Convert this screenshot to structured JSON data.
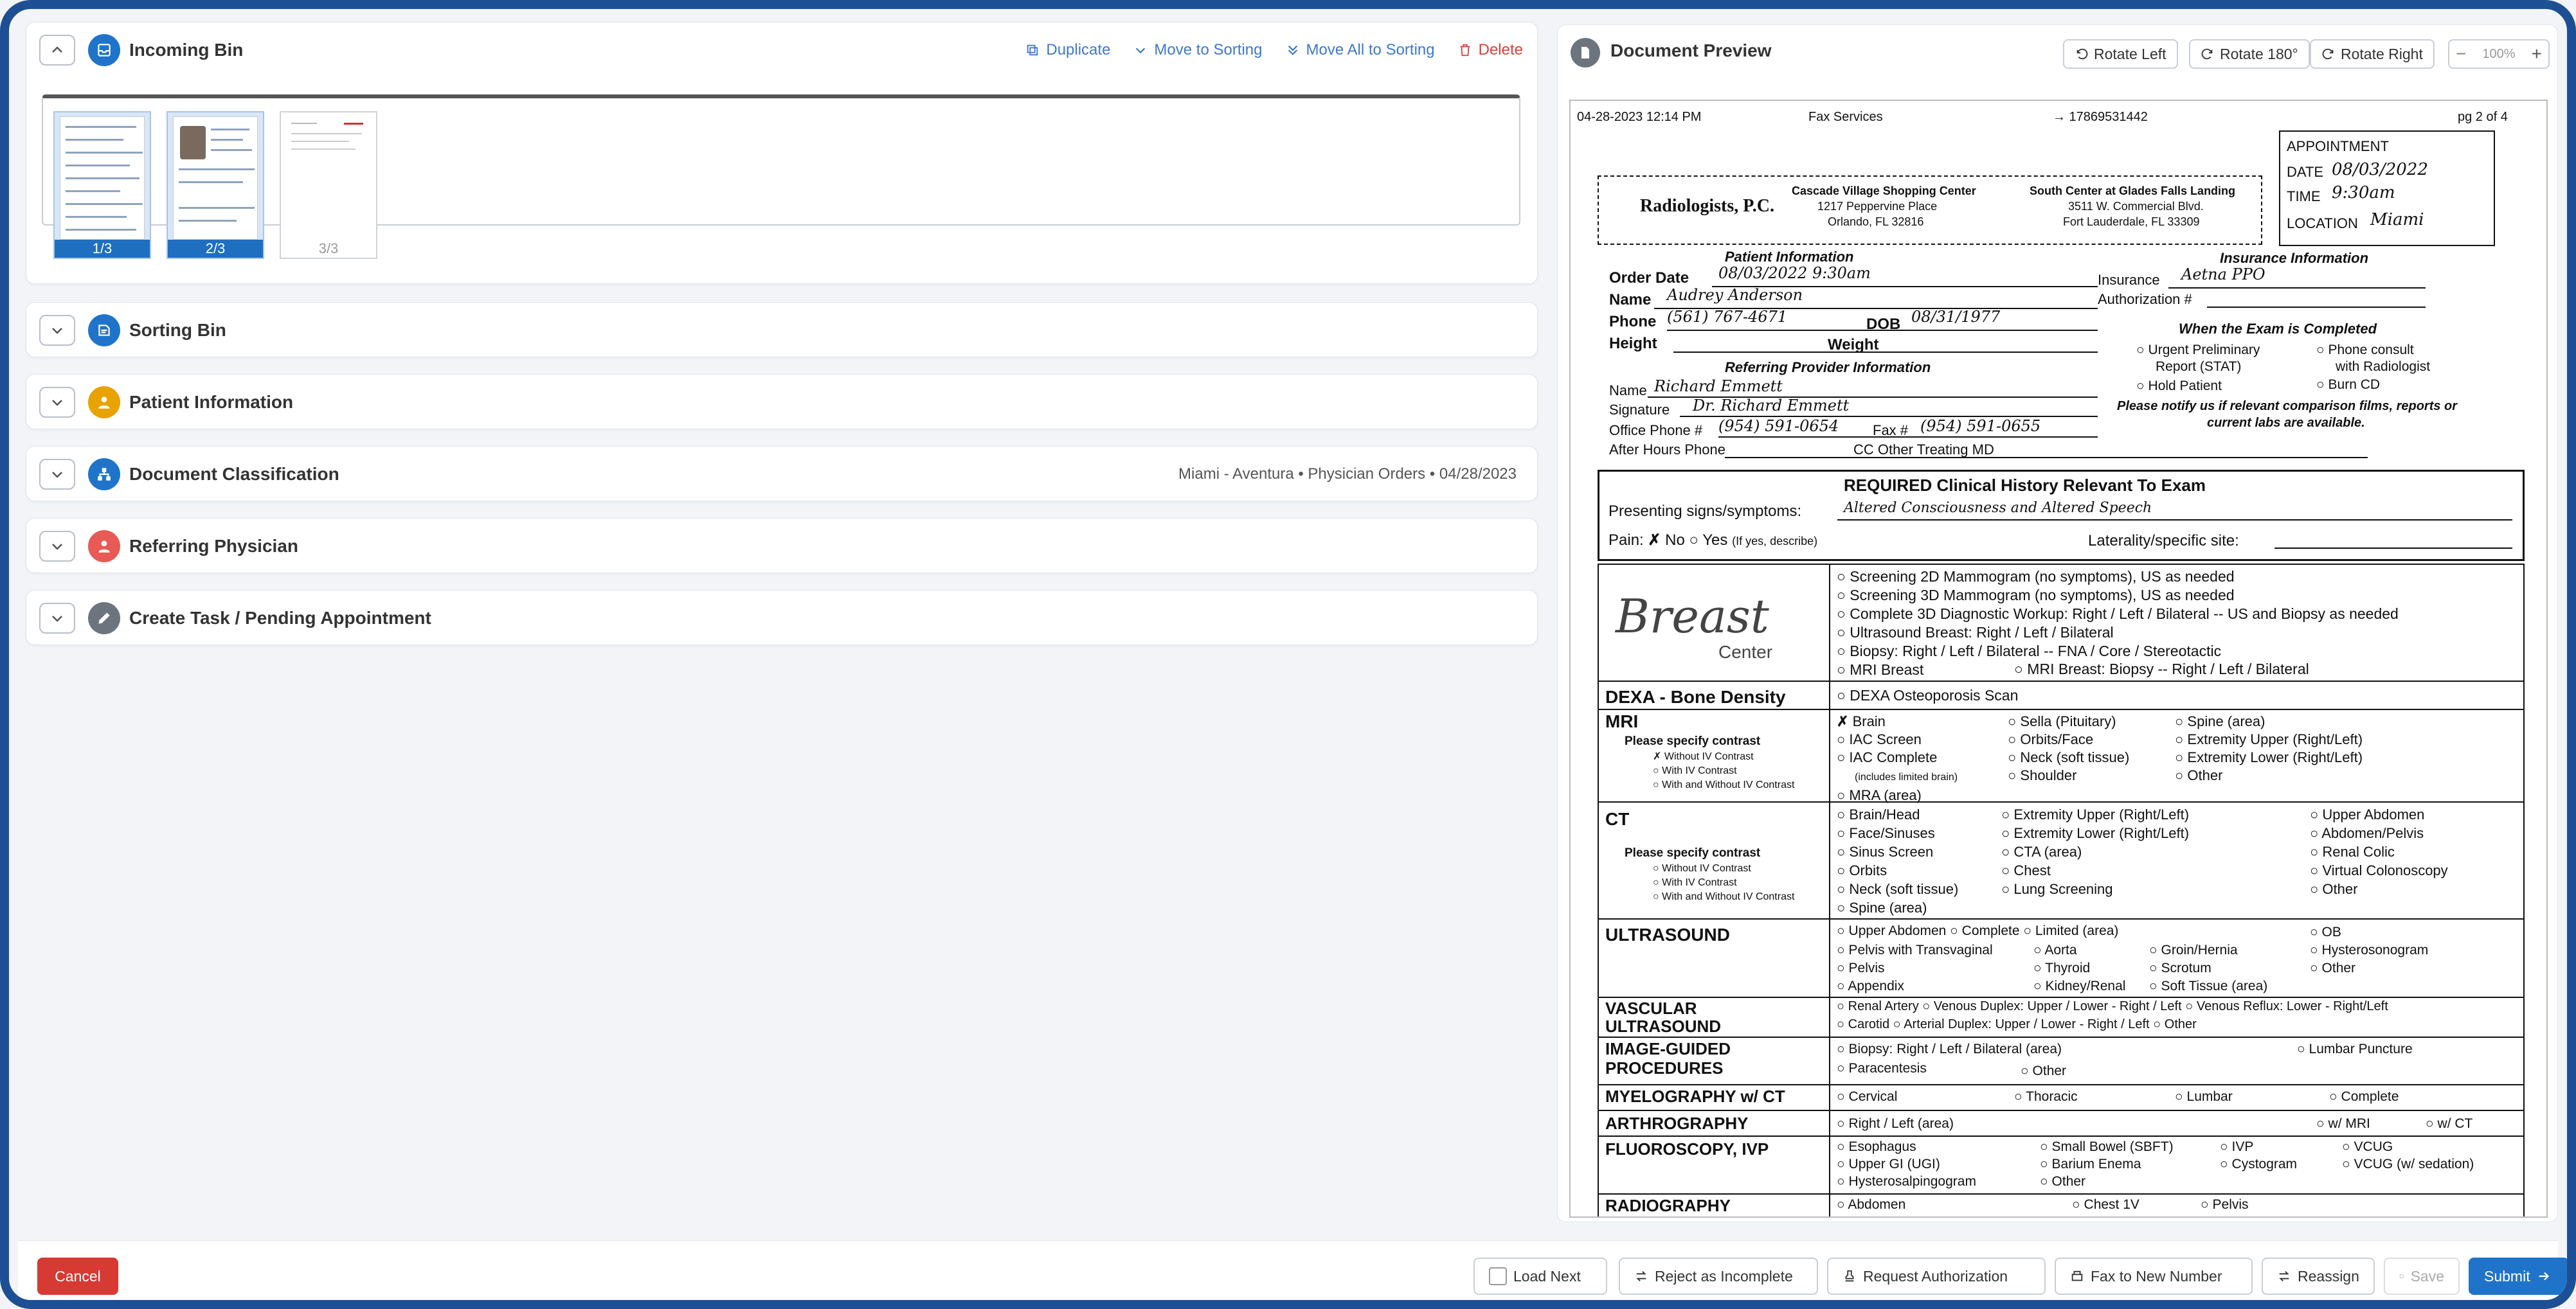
{
  "incoming_bin": {
    "title": "Incoming Bin",
    "actions": {
      "duplicate": "Duplicate",
      "move_to_sorting": "Move to Sorting",
      "move_all_to_sorting": "Move All to Sorting",
      "delete": "Delete"
    },
    "thumbnails": [
      {
        "label": "1/3",
        "selected": true
      },
      {
        "label": "2/3",
        "selected": true
      },
      {
        "label": "3/3",
        "selected": false
      }
    ]
  },
  "sections": {
    "sorting_bin": "Sorting Bin",
    "patient_information": "Patient Information",
    "document_classification": "Document Classification",
    "document_classification_meta": "Miami - Aventura  •  Physician Orders  •  04/28/2023",
    "referring_physician": "Referring Physician",
    "create_task": "Create Task / Pending Appointment"
  },
  "preview": {
    "title": "Document Preview",
    "rotate_left": "Rotate Left",
    "rotate_180": "Rotate 180°",
    "rotate_right": "Rotate Right",
    "zoom_level": "100%"
  },
  "doc": {
    "fax_date": "04-28-2023 12:14 PM",
    "fax_service": "Fax Services",
    "fax_number": "→ 17869531442",
    "page": "pg 2 of 4",
    "appointment": "APPOINTMENT",
    "appt_date_label": "DATE",
    "appt_date": "08/03/2022",
    "appt_time_label": "TIME",
    "appt_time": "9:30am",
    "appt_location_label": "LOCATION",
    "appt_location": "Miami",
    "logo": "Radiologists, P.C.",
    "center1_name": "Cascade Village Shopping Center",
    "center1_addr1": "1217 Peppervine Place",
    "center1_addr2": "Orlando, FL 32816",
    "center2_name": "South Center at Glades Falls Landing",
    "center2_addr1": "3511 W. Commercial Blvd.",
    "center2_addr2": "Fort Lauderdale, FL 33309",
    "patient_info_header": "Patient Information",
    "order_date_label": "Order Date",
    "order_date": "08/03/2022 9:30am",
    "name_label": "Name",
    "name": "Audrey Anderson",
    "phone_label": "Phone",
    "phone": "(561) 767-4671",
    "dob_label": "DOB",
    "dob": "08/31/1977",
    "height_label": "Height",
    "weight_label": "Weight",
    "insurance_header": "Insurance Information",
    "insurance_label": "Insurance",
    "insurance": "Aetna PPO",
    "authorization_label": "Authorization #",
    "exam_completed_header": "When the Exam is Completed",
    "urgent": "Urgent Preliminary",
    "urgent2": "Report (STAT)",
    "hold": "Hold Patient",
    "phone_consult": "Phone consult",
    "phone_consult2": "with Radiologist",
    "burn_cd": "Burn CD",
    "notify": "Please notify us if relevant comparison films, reports or",
    "notify2": "current labs are available.",
    "referring_header": "Referring Provider Information",
    "ref_name_label": "Name",
    "ref_name": "Richard Emmett",
    "signature_label": "Signature",
    "signature": "Dr. Richard Emmett",
    "office_phone_label": "Office Phone #",
    "office_phone": "(954) 591-0654",
    "fax_label": "Fax #",
    "fax": "(954) 591-0655",
    "after_hours_label": "After Hours Phone",
    "cc_label": "CC Other Treating MD",
    "clinical_header": "REQUIRED Clinical History Relevant To Exam",
    "presenting_label": "Presenting signs/symptoms:",
    "presenting": "Altered Consciousness and Altered Speech",
    "pain_label": "Pain:",
    "pain_no": "No",
    "pain_yes": "Yes",
    "pain_yes_note": "(If yes, describe)",
    "laterality_label": "Laterality/specific site:",
    "breast_logo": "Breast",
    "breast_center": "Center",
    "breast_items": [
      "Screening 2D Mammogram (no symptoms), US as needed",
      "Screening 3D Mammogram (no symptoms), US as needed",
      "Complete 3D Diagnostic Workup:  Right / Left / Bilateral -- US and Biopsy as needed",
      "Ultrasound Breast:  Right / Left / Bilateral",
      "Biopsy:  Right / Left / Bilateral -- FNA / Core / Stereotactic",
      "MRI Breast"
    ],
    "mri_breast_biopsy": "MRI Breast: Biopsy -- Right / Left / Bilateral",
    "dexa": "DEXA - Bone Density",
    "dexa_item": "DEXA Osteoporosis Scan",
    "mri": "MRI",
    "please_contrast": "Please specify contrast",
    "without_iv": "Without IV Contrast",
    "with_iv": "With IV Contrast",
    "with_without_iv": "With and Without IV Contrast",
    "mri_col1": [
      "Brain",
      "IAC Screen",
      "IAC Complete",
      "(includes limited brain)",
      "MRA (area)"
    ],
    "mri_col2": [
      "Sella (Pituitary)",
      "Orbits/Face",
      "Neck (soft tissue)",
      "Shoulder"
    ],
    "mri_col3": [
      "Spine (area)",
      "Extremity Upper (Right/Left)",
      "Extremity Lower (Right/Left)",
      "Other"
    ],
    "ct": "CT",
    "ct_col1": [
      "Brain/Head",
      "Face/Sinuses",
      "Sinus Screen",
      "Orbits",
      "Neck (soft tissue)",
      "Spine (area)"
    ],
    "ct_col2": [
      "Extremity Upper (Right/Left)",
      "Extremity Lower (Right/Left)",
      "CTA (area)",
      "Chest",
      "Lung Screening"
    ],
    "ct_col3": [
      "Upper Abdomen",
      "Abdomen/Pelvis",
      "Renal Colic",
      "Virtual Colonoscopy",
      "Other"
    ],
    "ultrasound": "ULTRASOUND",
    "us_row1": "Upper Abdomen   ○ Complete   ○ Limited (area)",
    "us_col1": [
      "Pelvis with Transvaginal",
      "Pelvis",
      "Appendix"
    ],
    "us_col2": [
      "Aorta",
      "Thyroid",
      "Kidney/Renal"
    ],
    "us_col3": [
      "Groin/Hernia",
      "Scrotum",
      "Soft Tissue (area)"
    ],
    "us_col4": [
      "OB",
      "Hysterosonogram",
      "Other"
    ],
    "vascular": "VASCULAR",
    "vascular2": "ULTRASOUND",
    "vasc_row1": "Renal Artery ○ Venous Duplex: Upper / Lower - Right / Left  ○ Venous Reflux: Lower - Right/Left",
    "vasc_row2": "Carotid    ○ Arterial Duplex: Upper / Lower - Right / Left  ○ Other",
    "image_guided": "IMAGE-GUIDED",
    "procedures": "PROCEDURES",
    "ig_row1": "Biopsy: Right / Left / Bilateral (area)",
    "ig_lumbar": "Lumbar Puncture",
    "ig_row2": "Paracentesis",
    "ig_other": "Other",
    "myelography": "MYELOGRAPHY w/ CT",
    "myelo_items": [
      "Cervical",
      "Thoracic",
      "Lumbar",
      "Complete"
    ],
    "arthrography": "ARTHROGRAPHY",
    "arthro_item": "Right / Left (area)",
    "arthro_mri": "w/ MRI",
    "arthro_ct": "w/ CT",
    "fluoroscopy": "FLUOROSCOPY, IVP",
    "fluoro_col1": [
      "Esophagus",
      "Upper GI (UGI)",
      "Hysterosalpingogram"
    ],
    "fluoro_col2": [
      "Small Bowel (SBFT)",
      "Barium Enema",
      "Other"
    ],
    "fluoro_col3": [
      "IVP",
      "Cystogram"
    ],
    "fluoro_col4": [
      "VCUG",
      "VCUG (w/ sedation)"
    ],
    "radiography": "RADIOGRAPHY",
    "radio_items": [
      "Abdomen",
      "Chest 1V",
      "Pelvis"
    ]
  },
  "footer": {
    "cancel": "Cancel",
    "load_next": "Load Next",
    "reject": "Reject as Incomplete",
    "request_auth": "Request Authorization",
    "fax_new": "Fax to New Number",
    "reassign": "Reassign",
    "save": "Save",
    "submit": "Submit"
  },
  "colors": {
    "frame": "#1d4f94",
    "primary": "#1f74c9",
    "danger": "#d63a33",
    "patient_icon": "#e8a300",
    "classification_icon": "#1f74c9",
    "referring_icon": "#e85a55",
    "task_icon": "#6c757d"
  }
}
